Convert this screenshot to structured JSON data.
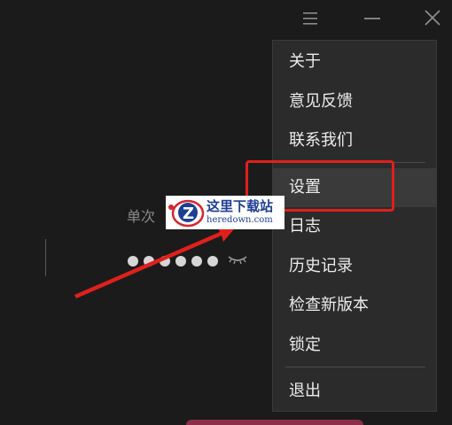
{
  "titlebar": {
    "menu_icon": "hamburger-icon",
    "minimize_icon": "minimize-icon",
    "close_icon": "close-icon"
  },
  "lock_screen": {
    "title": "单次",
    "password_dot_count": 6,
    "eye_icon": "eye-closed-icon"
  },
  "menu": {
    "groups": [
      [
        "关于",
        "意见反馈",
        "联系我们"
      ],
      [
        "设置",
        "日志",
        "历史记录",
        "检查新版本",
        "锁定"
      ],
      [
        "退出"
      ]
    ],
    "hovered": "设置"
  },
  "annotation": {
    "highlight_color": "#e0201b"
  },
  "watermark": {
    "cn": "这里下载站",
    "en": "heredown.com"
  },
  "colors": {
    "background": "#1b1b1c",
    "menu_bg": "#2b2b2c",
    "menu_hover": "#3a3a3b",
    "text": "#ececec",
    "accent": "#8a2f47"
  }
}
